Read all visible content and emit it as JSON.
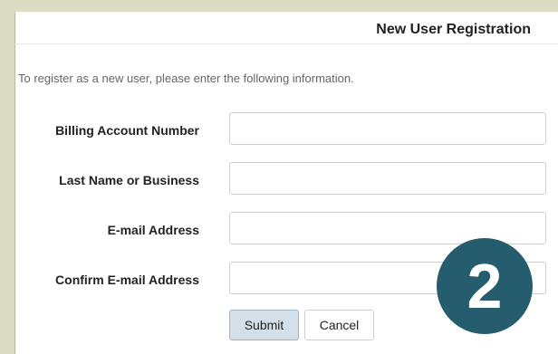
{
  "header": {
    "title": "New User Registration"
  },
  "intro": {
    "text": "To register as a new user, please enter the following information."
  },
  "form": {
    "fields": [
      {
        "label": "Billing Account Number",
        "value": "",
        "placeholder": ""
      },
      {
        "label": "Last Name or Business",
        "value": "",
        "placeholder": ""
      },
      {
        "label": "E-mail Address",
        "value": "",
        "placeholder": ""
      },
      {
        "label": "Confirm E-mail Address",
        "value": "",
        "placeholder": ""
      }
    ],
    "submit_label": "Submit",
    "cancel_label": "Cancel"
  },
  "overlay": {
    "step_number": "2"
  },
  "colors": {
    "page_background": "#dcdcc2",
    "badge": "#255c6e",
    "submit_button": "#d3e0ea"
  }
}
